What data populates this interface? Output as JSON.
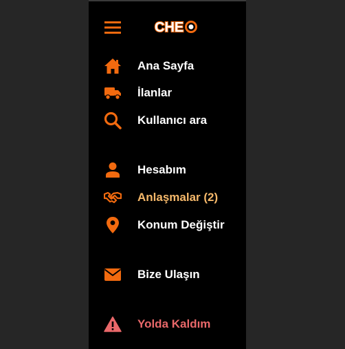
{
  "colors": {
    "accent": "#f26a0f",
    "active_label": "#f5b86a",
    "danger": "#e9686a",
    "panel_bg": "#000000",
    "page_bg": "#262626"
  },
  "header": {
    "menu_icon": "hamburger-icon",
    "logo_text": "CHEO"
  },
  "menu": {
    "items": [
      {
        "id": "home",
        "icon": "home-icon",
        "label": "Ana Sayfa"
      },
      {
        "id": "listings",
        "icon": "truck-icon",
        "label": "İlanlar"
      },
      {
        "id": "search-user",
        "icon": "search-icon",
        "label": "Kullanıcı ara"
      },
      {
        "id": "account",
        "icon": "user-icon",
        "label": "Hesabım"
      },
      {
        "id": "agreements",
        "icon": "handshake-icon",
        "label": "Anlaşmalar (2)",
        "active": true
      },
      {
        "id": "change-location",
        "icon": "location-pin-icon",
        "label": "Konum Değiştir"
      },
      {
        "id": "contact",
        "icon": "envelope-icon",
        "label": "Bize Ulaşın"
      },
      {
        "id": "stuck-on-road",
        "icon": "warning-icon",
        "label": "Yolda Kaldım",
        "danger": true
      }
    ]
  }
}
